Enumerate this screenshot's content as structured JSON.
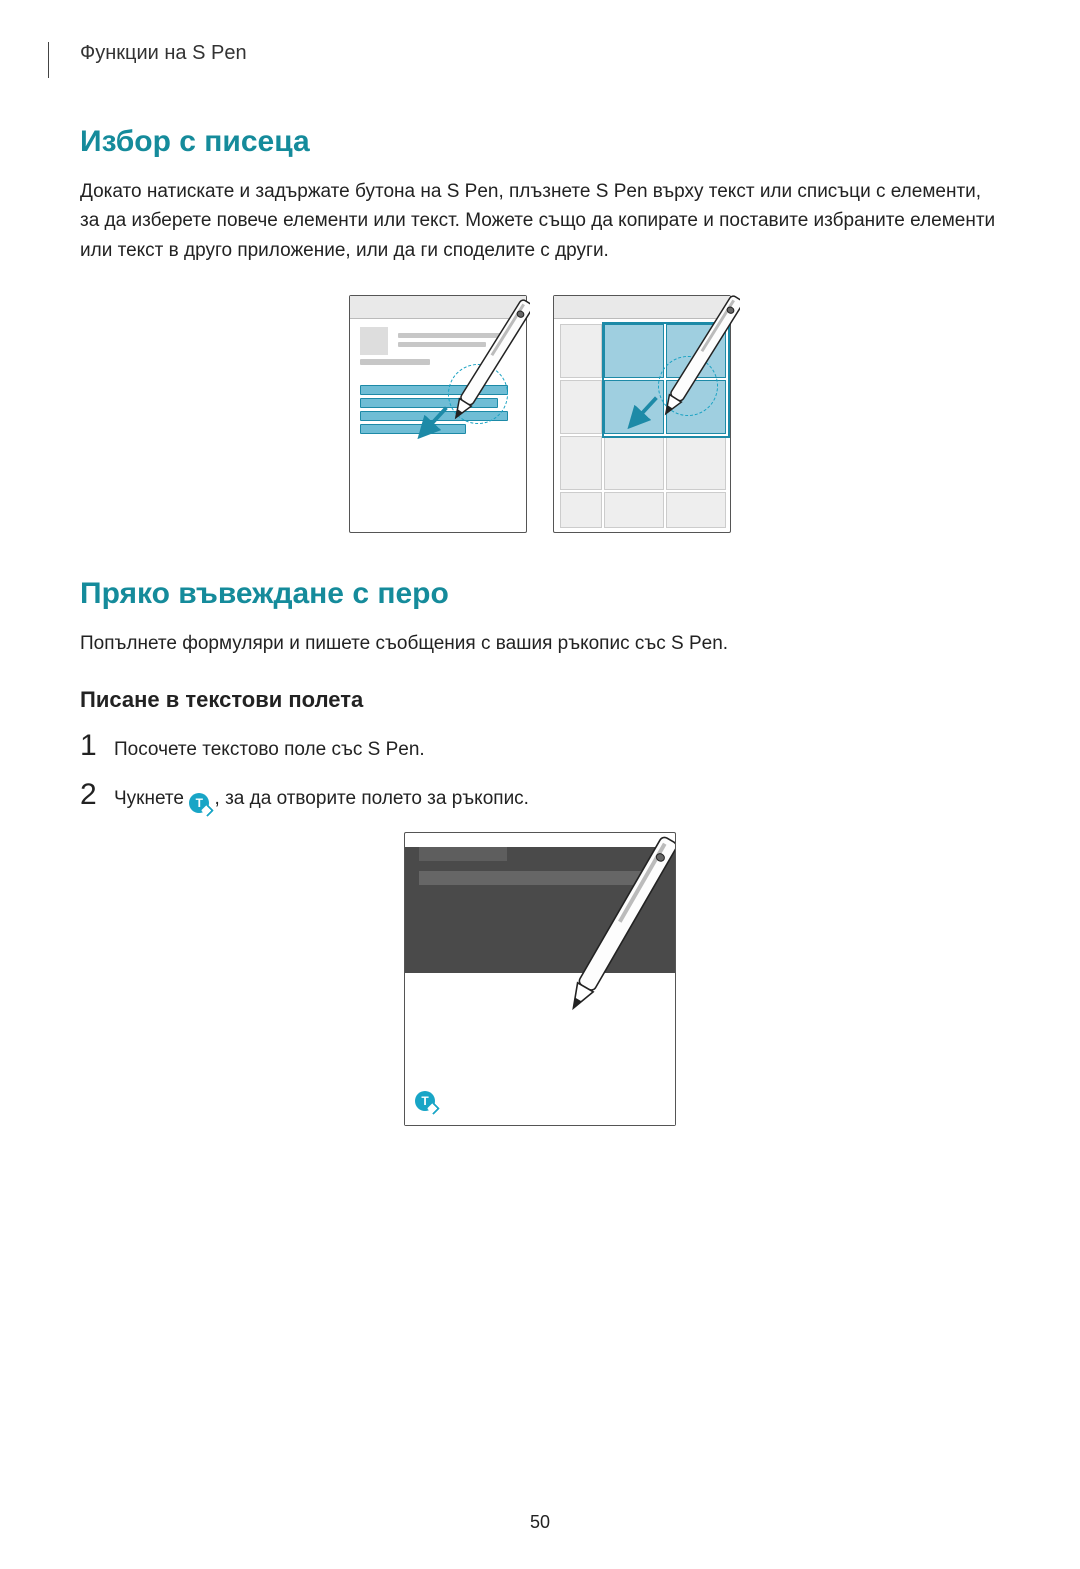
{
  "runningHead": "Функции на S Pen",
  "section1": {
    "title": "Избор с писеца",
    "body": "Докато натискате и задържате бутона на S Pen, плъзнете S Pen върху текст или списъци с елементи, за да изберете повече елементи или текст. Можете също да копирате и поставите избраните елементи или текст в друго приложение, или да ги споделите с други."
  },
  "section2": {
    "title": "Пряко въвеждане с перо",
    "intro": "Попълнете формуляри и пишете съобщения с вашия ръкопис със S Pen.",
    "subheading": "Писане в текстови полета",
    "steps": [
      "Посочете текстово поле със S Pen.",
      {
        "before": "Чукнете ",
        "after": ", за да отворите полето за ръкопис."
      }
    ]
  },
  "pageNumber": "50"
}
